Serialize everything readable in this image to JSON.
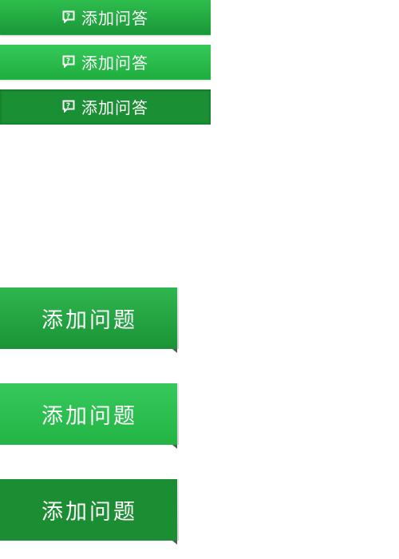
{
  "small_buttons": {
    "normal_label": "添加问答",
    "hover_label": "添加问答",
    "pressed_label": "添加问答",
    "icon": "question-bubble-icon"
  },
  "large_buttons": {
    "normal_label": "添加问题",
    "hover_label": "添加问题",
    "pressed_label": "添加问题"
  },
  "colors": {
    "green_normal": "#1fa33f",
    "green_hover": "#26bb48",
    "green_pressed": "#1b8d32",
    "text": "#ffffff"
  }
}
